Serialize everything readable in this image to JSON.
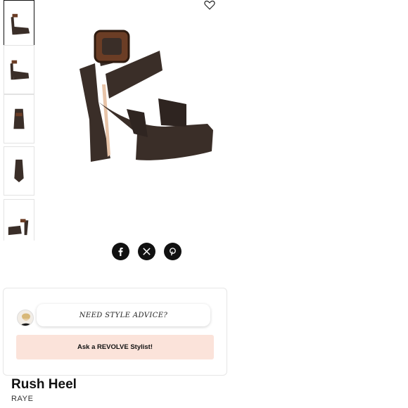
{
  "product": {
    "name": "Rush Heel",
    "brand": "RAYE"
  },
  "gallery": {
    "thumbnails": [
      "side-view",
      "side-view-alt",
      "back-view",
      "front-view",
      "angled-view"
    ],
    "active_index": 0
  },
  "icons": {
    "wishlist": "heart-icon",
    "social": [
      "facebook-icon",
      "x-icon",
      "pinterest-icon"
    ]
  },
  "stylist": {
    "prompt": "NEED STYLE ADVICE?",
    "button_label": "Ask a REVOLVE Stylist!"
  },
  "colors": {
    "shoe": "#3a2e28",
    "buckle": "#6b3d25",
    "stylist_button_bg": "#fbe3da",
    "social_bg": "#111111"
  }
}
